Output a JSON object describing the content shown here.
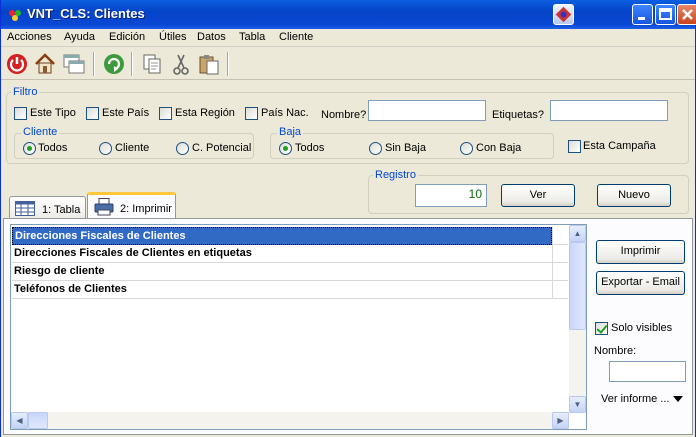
{
  "window": {
    "title": "VNT_CLS: Clientes"
  },
  "menu": [
    "Acciones",
    "Ayuda",
    "Edición",
    "Útiles",
    "Datos",
    "Tabla",
    "Cliente"
  ],
  "filtro": {
    "legend": "Filtro",
    "checks": [
      "Este Tipo",
      "Este País",
      "Esta Región",
      "País Nac."
    ],
    "nombre_label": "Nombre?",
    "nombre_value": "",
    "etiquetas_label": "Etiquetas?",
    "etiquetas_value": "",
    "cliente": {
      "legend": "Cliente",
      "options": [
        "Todos",
        "Cliente",
        "C. Potencial"
      ],
      "selected": "Todos"
    },
    "baja": {
      "legend": "Baja",
      "options": [
        "Todos",
        "Sin Baja",
        "Con Baja"
      ],
      "selected": "Todos"
    },
    "campana": "Esta Campaña"
  },
  "registro": {
    "legend": "Registro",
    "value": "10",
    "ver": "Ver",
    "nuevo": "Nuevo"
  },
  "tabs": [
    "1: Tabla",
    "2: Imprimir"
  ],
  "informes": [
    "Direcciones Fiscales de Clientes",
    "Direcciones Fiscales de Clientes en etiquetas",
    "Riesgo de cliente",
    "Teléfonos de Clientes"
  ],
  "side": {
    "imprimir": "Imprimir",
    "exportar": "Exportar - Email",
    "solo_visibles": "Solo visibles",
    "nombre_label": "Nombre:",
    "nombre_value": "",
    "ver_informe": "Ver informe ..."
  },
  "colors": {
    "titlebar": "#0543c8",
    "selection": "#316ac5",
    "legend": "#0046d5",
    "check": "#21a121"
  }
}
